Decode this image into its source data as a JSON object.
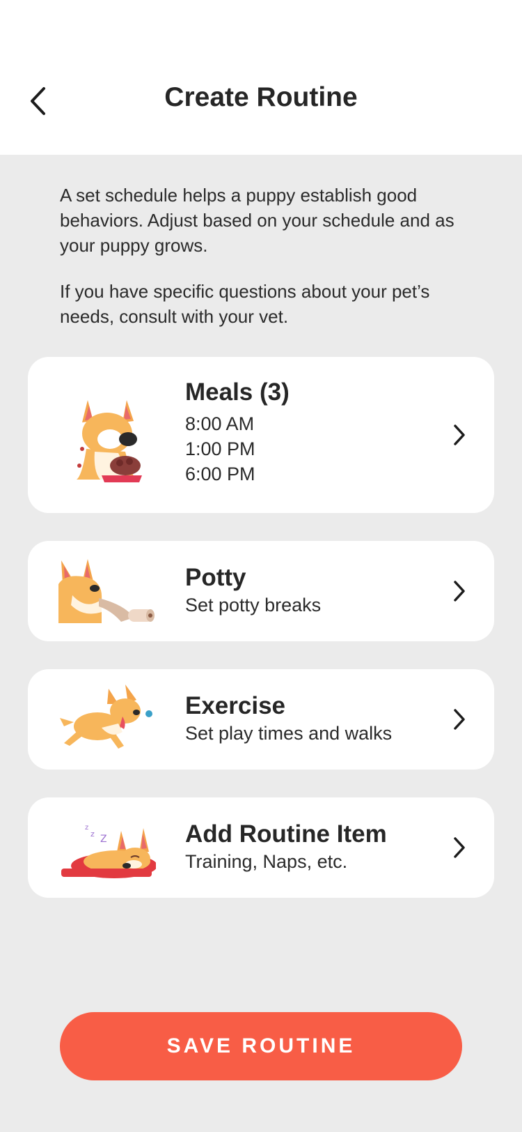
{
  "header": {
    "title": "Create Routine"
  },
  "intro": {
    "paragraph1": "A set schedule helps a puppy establish good behaviors. Adjust based on your schedule and as your puppy grows.",
    "paragraph2": "If you have specific questions about your pet’s needs, consult with your vet."
  },
  "cards": {
    "meals": {
      "title": "Meals (3)",
      "times": [
        "8:00 AM",
        "1:00 PM",
        "6:00 PM"
      ]
    },
    "potty": {
      "title": "Potty",
      "subtitle": "Set potty breaks"
    },
    "exercise": {
      "title": "Exercise",
      "subtitle": "Set play times and walks"
    },
    "add": {
      "title": "Add Routine Item",
      "subtitle": "Training, Naps, etc."
    }
  },
  "save_button": {
    "label": "SAVE ROUTINE"
  },
  "colors": {
    "accent": "#f85d46",
    "background": "#ebebeb",
    "card": "#ffffff"
  }
}
